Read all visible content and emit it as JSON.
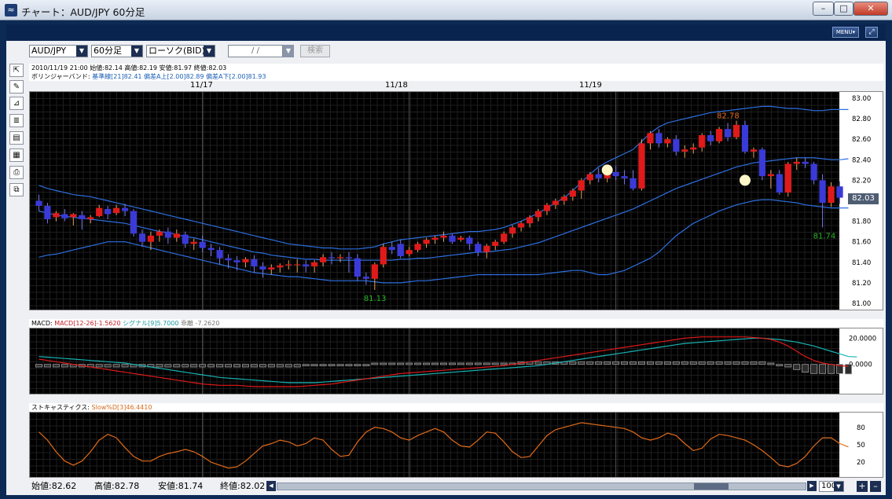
{
  "window": {
    "title": "チャート：AUD/JPY 60分足",
    "minimize": "–",
    "maximize": "□",
    "close": "✕"
  },
  "toolbar": {
    "menu_label": "MENU▾",
    "expand": "⤢",
    "pair": "AUD/JPY",
    "timeframe": "60分足",
    "chart_type": "ローソク(BID)",
    "date_value": "/   /",
    "search_label": "検索",
    "dropdown_arrow": "▼"
  },
  "tools": [
    "⇱",
    "✎",
    "⊿",
    "≣",
    "▤",
    "▦",
    "⎙",
    "⧉"
  ],
  "price_info": {
    "ohlc_line": "2010/11/19 21:00  始値:82.14  高値:82.19  安値:81.97  終値:82.03",
    "bb_label": "ボリンジャーバンド:",
    "bb_mid": "基準線[21]82.41",
    "bb_upper": "偏差A上[2.00]82.89",
    "bb_lower": "偏差A下[2.00]81.93"
  },
  "x_dates": [
    "11/17",
    "11/18",
    "11/19"
  ],
  "y_ticks": [
    "83.00",
    "82.80",
    "82.60",
    "82.40",
    "82.20",
    "82.00",
    "81.80",
    "81.60",
    "81.40",
    "81.20",
    "81.00"
  ],
  "current_price": "82.03",
  "annotations": {
    "high": "82.78",
    "low1": "81.13",
    "low2": "81.74"
  },
  "macd": {
    "label": "MACD:",
    "macd": "MACD[12-26]-1.5620",
    "signal": "シグナル[9]5.7000",
    "divergence": "乖離 -7.2620",
    "ticks": [
      "20.0000",
      "0.0000"
    ]
  },
  "stoch": {
    "label": "ストキャスティクス:",
    "slow": "Slow%D[3]46.4410",
    "ticks": [
      "80",
      "50",
      "20"
    ]
  },
  "status": {
    "open": "始値:82.62",
    "high": "高値:82.78",
    "low": "安値:81.74",
    "close": "終値:82.02",
    "count": "100",
    "zoom_in": "+",
    "zoom_out": "–",
    "scroll_left": "◀",
    "scroll_right": "▶"
  },
  "colors": {
    "up_candle": "#e01a1a",
    "down_candle": "#3a3ad8",
    "band": "#2d6fe0",
    "macd_line": "#e01a1a",
    "signal_line": "#18b4b4",
    "stoch_line": "#e06a1a",
    "low_annotation": "#28b428",
    "high_annotation": "#e06a1a"
  },
  "chart_data": {
    "type": "candlestick",
    "ylim": [
      81.0,
      83.0
    ],
    "candles": [
      {
        "o": 82.0,
        "h": 82.06,
        "c": 81.95,
        "l": 81.9
      },
      {
        "o": 81.95,
        "h": 81.98,
        "c": 81.82,
        "l": 81.78
      },
      {
        "o": 81.84,
        "h": 81.9,
        "c": 81.88,
        "l": 81.8
      },
      {
        "o": 81.87,
        "h": 81.92,
        "c": 81.83,
        "l": 81.8
      },
      {
        "o": 81.84,
        "h": 81.88,
        "c": 81.87,
        "l": 81.76
      },
      {
        "o": 81.86,
        "h": 81.9,
        "c": 81.82,
        "l": 81.72
      },
      {
        "o": 81.82,
        "h": 81.86,
        "c": 81.84,
        "l": 81.78
      },
      {
        "o": 81.85,
        "h": 81.96,
        "c": 81.93,
        "l": 81.84
      },
      {
        "o": 81.92,
        "h": 81.95,
        "c": 81.87,
        "l": 81.82
      },
      {
        "o": 81.88,
        "h": 81.96,
        "c": 81.93,
        "l": 81.86
      },
      {
        "o": 81.93,
        "h": 81.97,
        "c": 81.9,
        "l": 81.85
      },
      {
        "o": 81.9,
        "h": 81.92,
        "c": 81.68,
        "l": 81.65
      },
      {
        "o": 81.68,
        "h": 81.72,
        "c": 81.6,
        "l": 81.55
      },
      {
        "o": 81.6,
        "h": 81.7,
        "c": 81.66,
        "l": 81.52
      },
      {
        "o": 81.66,
        "h": 81.72,
        "c": 81.7,
        "l": 81.6
      },
      {
        "o": 81.7,
        "h": 81.74,
        "c": 81.64,
        "l": 81.58
      },
      {
        "o": 81.64,
        "h": 81.72,
        "c": 81.68,
        "l": 81.6
      },
      {
        "o": 81.67,
        "h": 81.7,
        "c": 81.58,
        "l": 81.54
      },
      {
        "o": 81.58,
        "h": 81.63,
        "c": 81.6,
        "l": 81.52
      },
      {
        "o": 81.6,
        "h": 81.66,
        "c": 81.54,
        "l": 81.5
      },
      {
        "o": 81.54,
        "h": 81.58,
        "c": 81.52,
        "l": 81.46
      },
      {
        "o": 81.52,
        "h": 81.55,
        "c": 81.44,
        "l": 81.38
      },
      {
        "o": 81.44,
        "h": 81.48,
        "c": 81.42,
        "l": 81.34
      },
      {
        "o": 81.42,
        "h": 81.46,
        "c": 81.4,
        "l": 81.32
      },
      {
        "o": 81.4,
        "h": 81.45,
        "c": 81.43,
        "l": 81.35
      },
      {
        "o": 81.43,
        "h": 81.47,
        "c": 81.36,
        "l": 81.3
      },
      {
        "o": 81.36,
        "h": 81.4,
        "c": 81.33,
        "l": 81.25
      },
      {
        "o": 81.33,
        "h": 81.38,
        "c": 81.35,
        "l": 81.28
      },
      {
        "o": 81.35,
        "h": 81.39,
        "c": 81.37,
        "l": 81.3
      },
      {
        "o": 81.37,
        "h": 81.42,
        "c": 81.38,
        "l": 81.33
      },
      {
        "o": 81.38,
        "h": 81.43,
        "c": 81.38,
        "l": 81.3
      },
      {
        "o": 81.38,
        "h": 81.42,
        "c": 81.36,
        "l": 81.3
      },
      {
        "o": 81.36,
        "h": 81.42,
        "c": 81.4,
        "l": 81.3
      },
      {
        "o": 81.4,
        "h": 81.48,
        "c": 81.45,
        "l": 81.36
      },
      {
        "o": 81.45,
        "h": 81.5,
        "c": 81.44,
        "l": 81.38
      },
      {
        "o": 81.44,
        "h": 81.48,
        "c": 81.45,
        "l": 81.4
      },
      {
        "o": 81.45,
        "h": 81.5,
        "c": 81.44,
        "l": 81.3
      },
      {
        "o": 81.44,
        "h": 81.48,
        "c": 81.26,
        "l": 81.22
      },
      {
        "o": 81.26,
        "h": 81.3,
        "c": 81.24,
        "l": 81.18
      },
      {
        "o": 81.24,
        "h": 81.4,
        "c": 81.38,
        "l": 81.13
      },
      {
        "o": 81.38,
        "h": 81.58,
        "c": 81.55,
        "l": 81.35
      },
      {
        "o": 81.55,
        "h": 81.6,
        "c": 81.52,
        "l": 81.48
      },
      {
        "o": 81.58,
        "h": 81.62,
        "c": 81.46,
        "l": 81.44
      },
      {
        "o": 81.48,
        "h": 81.55,
        "c": 81.52,
        "l": 81.46
      },
      {
        "o": 81.52,
        "h": 81.6,
        "c": 81.58,
        "l": 81.5
      },
      {
        "o": 81.58,
        "h": 81.64,
        "c": 81.62,
        "l": 81.54
      },
      {
        "o": 81.62,
        "h": 81.66,
        "c": 81.64,
        "l": 81.58
      },
      {
        "o": 81.64,
        "h": 81.7,
        "c": 81.66,
        "l": 81.6
      },
      {
        "o": 81.66,
        "h": 81.68,
        "c": 81.6,
        "l": 81.58
      },
      {
        "o": 81.62,
        "h": 81.66,
        "c": 81.64,
        "l": 81.6
      },
      {
        "o": 81.64,
        "h": 81.66,
        "c": 81.58,
        "l": 81.52
      },
      {
        "o": 81.58,
        "h": 81.6,
        "c": 81.5,
        "l": 81.46
      },
      {
        "o": 81.5,
        "h": 81.58,
        "c": 81.56,
        "l": 81.44
      },
      {
        "o": 81.56,
        "h": 81.62,
        "c": 81.6,
        "l": 81.52
      },
      {
        "o": 81.6,
        "h": 81.7,
        "c": 81.68,
        "l": 81.58
      },
      {
        "o": 81.68,
        "h": 81.76,
        "c": 81.74,
        "l": 81.64
      },
      {
        "o": 81.74,
        "h": 81.8,
        "c": 81.78,
        "l": 81.7
      },
      {
        "o": 81.78,
        "h": 81.86,
        "c": 81.84,
        "l": 81.74
      },
      {
        "o": 81.84,
        "h": 81.92,
        "c": 81.9,
        "l": 81.8
      },
      {
        "o": 81.9,
        "h": 81.98,
        "c": 81.96,
        "l": 81.86
      },
      {
        "o": 81.96,
        "h": 82.02,
        "c": 82.0,
        "l": 81.92
      },
      {
        "o": 82.0,
        "h": 82.06,
        "c": 82.04,
        "l": 81.96
      },
      {
        "o": 82.04,
        "h": 82.12,
        "c": 82.1,
        "l": 82.0
      },
      {
        "o": 82.1,
        "h": 82.22,
        "c": 82.2,
        "l": 82.02
      },
      {
        "o": 82.2,
        "h": 82.28,
        "c": 82.26,
        "l": 82.16
      },
      {
        "o": 82.26,
        "h": 82.32,
        "c": 82.22,
        "l": 82.18
      },
      {
        "o": 82.22,
        "h": 82.3,
        "c": 82.28,
        "l": 82.18
      },
      {
        "o": 82.28,
        "h": 82.34,
        "c": 82.24,
        "l": 82.2
      },
      {
        "o": 82.24,
        "h": 82.3,
        "c": 82.22,
        "l": 82.16
      },
      {
        "o": 82.22,
        "h": 82.3,
        "c": 82.12,
        "l": 82.1
      },
      {
        "o": 82.12,
        "h": 82.6,
        "c": 82.56,
        "l": 82.1
      },
      {
        "o": 82.56,
        "h": 82.68,
        "c": 82.66,
        "l": 82.5
      },
      {
        "o": 82.66,
        "h": 82.7,
        "c": 82.56,
        "l": 82.52
      },
      {
        "o": 82.56,
        "h": 82.62,
        "c": 82.6,
        "l": 82.52
      },
      {
        "o": 82.6,
        "h": 82.64,
        "c": 82.48,
        "l": 82.44
      },
      {
        "o": 82.48,
        "h": 82.54,
        "c": 82.5,
        "l": 82.42
      },
      {
        "o": 82.5,
        "h": 82.56,
        "c": 82.52,
        "l": 82.46
      },
      {
        "o": 82.52,
        "h": 82.66,
        "c": 82.64,
        "l": 82.48
      },
      {
        "o": 82.64,
        "h": 82.68,
        "c": 82.58,
        "l": 82.54
      },
      {
        "o": 82.58,
        "h": 82.72,
        "c": 82.7,
        "l": 82.56
      },
      {
        "o": 82.7,
        "h": 82.76,
        "c": 82.62,
        "l": 82.58
      },
      {
        "o": 82.62,
        "h": 82.78,
        "c": 82.74,
        "l": 82.6
      },
      {
        "o": 82.74,
        "h": 82.78,
        "c": 82.48,
        "l": 82.46
      },
      {
        "o": 82.48,
        "h": 82.52,
        "c": 82.5,
        "l": 82.42
      },
      {
        "o": 82.5,
        "h": 82.52,
        "c": 82.24,
        "l": 82.2
      },
      {
        "o": 82.24,
        "h": 82.3,
        "c": 82.26,
        "l": 82.12
      },
      {
        "o": 82.26,
        "h": 82.3,
        "c": 82.08,
        "l": 82.06
      },
      {
        "o": 82.08,
        "h": 82.38,
        "c": 82.36,
        "l": 82.04
      },
      {
        "o": 82.36,
        "h": 82.42,
        "c": 82.38,
        "l": 82.3
      },
      {
        "o": 82.38,
        "h": 82.42,
        "c": 82.36,
        "l": 82.32
      },
      {
        "o": 82.36,
        "h": 82.38,
        "c": 82.2,
        "l": 82.16
      },
      {
        "o": 82.2,
        "h": 82.26,
        "c": 81.98,
        "l": 81.74
      },
      {
        "o": 81.98,
        "h": 82.18,
        "c": 82.14,
        "l": 81.94
      },
      {
        "o": 82.14,
        "h": 82.19,
        "c": 82.03,
        "l": 81.97
      }
    ],
    "bb_mid": [
      81.9,
      81.88,
      81.86,
      81.85,
      81.84,
      81.83,
      81.82,
      81.81,
      81.8,
      81.79,
      81.78,
      81.76,
      81.74,
      81.72,
      81.7,
      81.69,
      81.67,
      81.65,
      81.64,
      81.62,
      81.6,
      81.58,
      81.56,
      81.54,
      81.52,
      81.5,
      81.49,
      81.47,
      81.46,
      81.45,
      81.44,
      81.43,
      81.43,
      81.42,
      81.42,
      81.42,
      81.42,
      81.42,
      81.42,
      81.42,
      81.42,
      81.42,
      81.43,
      81.43,
      81.44,
      81.44,
      81.45,
      81.46,
      81.47,
      81.48,
      81.49,
      81.5,
      81.5,
      81.51,
      81.52,
      81.53,
      81.55,
      81.57,
      81.59,
      81.62,
      81.65,
      81.68,
      81.71,
      81.74,
      81.77,
      81.8,
      81.83,
      81.86,
      81.89,
      81.92,
      81.96,
      82.0,
      82.04,
      82.08,
      82.12,
      82.15,
      82.18,
      82.21,
      82.24,
      82.27,
      82.3,
      82.33,
      82.35,
      82.37,
      82.38,
      82.39,
      82.4,
      82.41,
      82.42,
      82.42,
      82.42,
      82.41,
      82.4,
      82.4,
      82.41
    ],
    "bb_upper": [
      82.15,
      82.12,
      82.1,
      82.08,
      82.06,
      82.05,
      82.04,
      82.02,
      82.0,
      81.98,
      81.96,
      81.94,
      81.92,
      81.9,
      81.88,
      81.86,
      81.84,
      81.82,
      81.8,
      81.78,
      81.76,
      81.74,
      81.72,
      81.7,
      81.68,
      81.66,
      81.64,
      81.62,
      81.6,
      81.58,
      81.57,
      81.56,
      81.55,
      81.54,
      81.54,
      81.53,
      81.53,
      81.53,
      81.54,
      81.55,
      81.58,
      81.6,
      81.62,
      81.63,
      81.64,
      81.65,
      81.66,
      81.67,
      81.68,
      81.69,
      81.7,
      81.7,
      81.71,
      81.72,
      81.74,
      81.77,
      81.8,
      81.84,
      81.88,
      81.93,
      81.98,
      82.03,
      82.1,
      82.18,
      82.26,
      82.33,
      82.38,
      82.42,
      82.46,
      82.5,
      82.58,
      82.66,
      82.72,
      82.76,
      82.78,
      82.8,
      82.82,
      82.84,
      82.86,
      82.87,
      82.88,
      82.89,
      82.9,
      82.91,
      82.92,
      82.92,
      82.91,
      82.9,
      82.9,
      82.89,
      82.88,
      82.88,
      82.89,
      82.89,
      82.89
    ],
    "bb_lower": [
      81.45,
      81.47,
      81.48,
      81.5,
      81.52,
      81.54,
      81.56,
      81.58,
      81.6,
      81.6,
      81.6,
      81.58,
      81.56,
      81.54,
      81.52,
      81.5,
      81.48,
      81.46,
      81.44,
      81.42,
      81.4,
      81.38,
      81.36,
      81.34,
      81.32,
      81.3,
      81.29,
      81.28,
      81.27,
      81.26,
      81.26,
      81.25,
      81.24,
      81.23,
      81.22,
      81.22,
      81.22,
      81.22,
      81.22,
      81.21,
      81.2,
      81.2,
      81.2,
      81.21,
      81.22,
      81.22,
      81.23,
      81.24,
      81.25,
      81.26,
      81.27,
      81.28,
      81.28,
      81.28,
      81.28,
      81.28,
      81.28,
      81.28,
      81.28,
      81.29,
      81.3,
      81.31,
      81.32,
      81.32,
      81.3,
      81.28,
      81.28,
      81.3,
      81.32,
      81.36,
      81.4,
      81.44,
      81.5,
      81.58,
      81.66,
      81.72,
      81.78,
      81.82,
      81.86,
      81.9,
      81.93,
      81.96,
      81.98,
      82.0,
      82.01,
      82.01,
      82.0,
      81.99,
      81.98,
      81.96,
      81.95,
      81.94,
      81.93,
      81.93,
      81.93
    ],
    "macd": {
      "ylim": [
        -20,
        25
      ],
      "macd_line": [
        4,
        3,
        2,
        1,
        0,
        -1,
        -2,
        -3,
        -4,
        -5,
        -6,
        -7,
        -8,
        -9,
        -10,
        -11,
        -12,
        -13,
        -14,
        -15,
        -15.5,
        -16,
        -16,
        -16,
        -16.5,
        -17,
        -17,
        -17,
        -17,
        -17,
        -17,
        -16.5,
        -16,
        -15.5,
        -15,
        -14,
        -13,
        -12,
        -11,
        -10,
        -9,
        -8,
        -7,
        -6.5,
        -6,
        -5.5,
        -5,
        -4.5,
        -4,
        -3.5,
        -3,
        -2.5,
        -2,
        -1.5,
        -1,
        0,
        1,
        2,
        3,
        4,
        5,
        6,
        7,
        8,
        9,
        10,
        11,
        12,
        13,
        14,
        15,
        16,
        17,
        18,
        19,
        20,
        20.5,
        21,
        21,
        21,
        21,
        21,
        21,
        20.5,
        20,
        19,
        17,
        14,
        10,
        6,
        3,
        1,
        0,
        -1,
        -1.5
      ],
      "signal_line": [
        6,
        5.5,
        5,
        4.5,
        4,
        3.5,
        3,
        2.5,
        2,
        1.5,
        1,
        0,
        -1,
        -2,
        -3,
        -4,
        -5,
        -6,
        -7,
        -8,
        -9,
        -10,
        -10.5,
        -11,
        -11.5,
        -12,
        -12.5,
        -13,
        -13.5,
        -14,
        -14,
        -14,
        -14,
        -13.5,
        -13,
        -12.5,
        -12,
        -11.5,
        -11,
        -10.5,
        -10,
        -9.5,
        -9,
        -8.5,
        -8,
        -7.5,
        -7,
        -6.5,
        -6,
        -5.5,
        -5,
        -4.5,
        -4,
        -3.5,
        -3,
        -2.5,
        -2,
        -1.5,
        -1,
        0,
        1,
        2,
        3,
        4,
        5,
        6,
        7,
        8,
        9,
        10,
        11,
        12,
        13,
        14,
        15,
        16,
        16.5,
        17,
        17.5,
        18,
        18.5,
        19,
        19.5,
        20,
        20,
        19.5,
        19,
        18,
        17,
        15.5,
        14,
        12,
        10,
        8,
        6,
        5.7
      ],
      "histogram": [
        -2,
        -2,
        -2,
        -2,
        -2,
        -2,
        -2,
        -2,
        -2,
        -2,
        -2,
        -2,
        -2,
        -2,
        -2,
        -2,
        -2,
        -2,
        -2,
        -2,
        -2,
        -2,
        -2,
        -2,
        -2,
        -2,
        -2,
        -2,
        -2,
        -2,
        -2,
        -1,
        -1,
        -1,
        -1,
        -1,
        -1,
        0,
        0,
        1,
        1,
        1,
        1,
        1,
        1,
        1,
        1,
        1,
        1,
        1,
        1,
        1,
        1,
        1,
        1,
        1,
        2,
        2,
        2,
        2,
        2,
        2,
        2,
        2,
        2,
        2,
        2,
        2,
        2,
        2,
        2,
        2,
        2,
        2,
        2,
        2,
        2,
        2,
        2,
        2,
        2,
        2,
        2,
        2,
        2,
        1,
        0,
        -2,
        -4,
        -6,
        -7,
        -7,
        -7,
        -7,
        -7.3
      ]
    },
    "stochastic": {
      "ylim": [
        0,
        100
      ],
      "slow_d": [
        72,
        58,
        38,
        22,
        15,
        22,
        38,
        58,
        68,
        62,
        45,
        30,
        22,
        22,
        30,
        35,
        38,
        42,
        38,
        30,
        20,
        15,
        10,
        12,
        22,
        35,
        48,
        52,
        58,
        55,
        48,
        52,
        62,
        58,
        42,
        30,
        32,
        55,
        72,
        80,
        78,
        72,
        62,
        58,
        66,
        72,
        78,
        72,
        58,
        48,
        46,
        58,
        72,
        70,
        55,
        38,
        28,
        30,
        48,
        66,
        76,
        80,
        84,
        88,
        86,
        84,
        82,
        80,
        78,
        72,
        62,
        58,
        62,
        70,
        66,
        52,
        40,
        44,
        60,
        68,
        66,
        62,
        58,
        50,
        40,
        28,
        15,
        12,
        18,
        30,
        48,
        62,
        62,
        52,
        46.4
      ]
    },
    "x_labels": {
      "11/17": 19,
      "11/18": 43,
      "11/19": 67
    }
  }
}
